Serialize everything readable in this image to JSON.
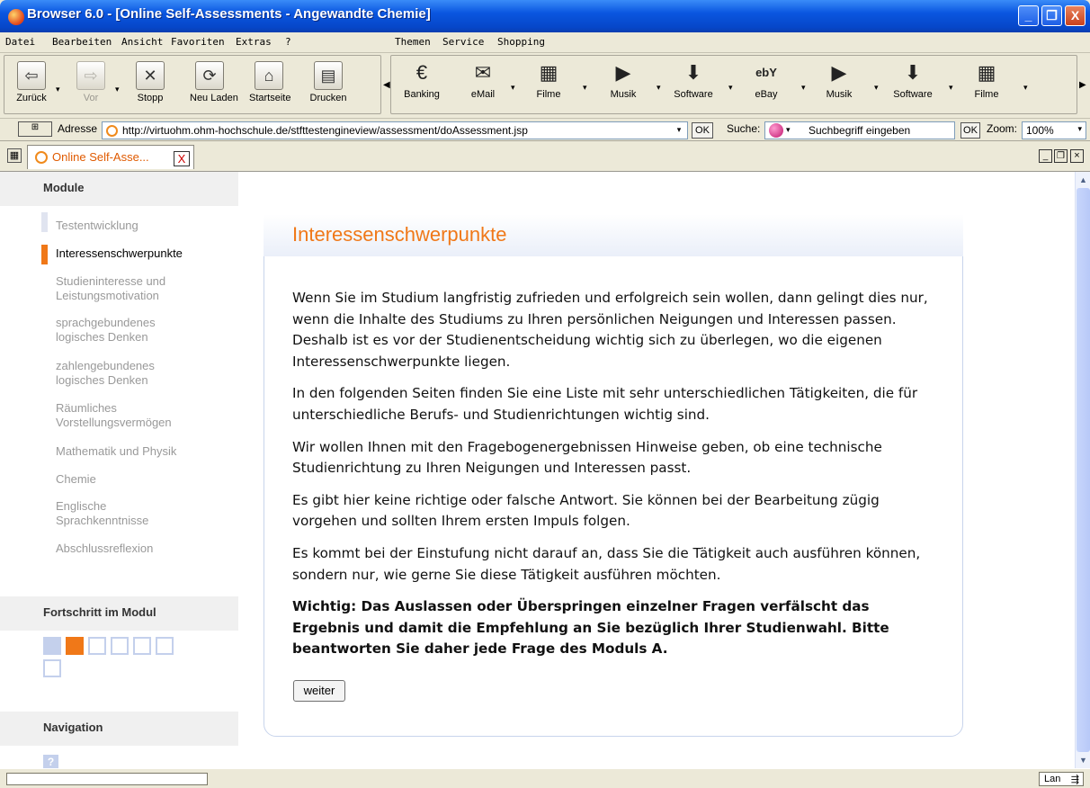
{
  "window": {
    "title": "Browser 6.0 - [Online Self-Assessments - Angewandte Chemie]",
    "minimize": "_",
    "maximize": "❐",
    "close": "X"
  },
  "menubar": {
    "items": [
      "Datei",
      "Bearbeiten",
      "Ansicht",
      "Favoriten",
      "Extras",
      "?",
      "Themen",
      "Service",
      "Shopping"
    ]
  },
  "toolbar": {
    "nav": [
      {
        "label": "Zurück",
        "icon": "back-arrow-icon",
        "glyph": "⇦"
      },
      {
        "label": "Vor",
        "icon": "forward-arrow-icon",
        "glyph": "⇨"
      },
      {
        "label": "Stopp",
        "icon": "stop-icon",
        "glyph": "✕"
      },
      {
        "label": "Neu Laden",
        "icon": "reload-icon",
        "glyph": "⟳"
      },
      {
        "label": "Startseite",
        "icon": "home-icon",
        "glyph": "⌂"
      },
      {
        "label": "Drucken",
        "icon": "print-icon",
        "glyph": "▤"
      }
    ],
    "links": [
      {
        "label": "Banking",
        "icon": "euro-icon",
        "glyph": "€"
      },
      {
        "label": "eMail",
        "icon": "mail-icon",
        "glyph": "✉"
      },
      {
        "label": "Filme",
        "icon": "film-icon",
        "glyph": "▦"
      },
      {
        "label": "Musik",
        "icon": "play-icon",
        "glyph": "▶"
      },
      {
        "label": "Software",
        "icon": "download-icon",
        "glyph": "⬇"
      },
      {
        "label": "eBay",
        "icon": "ebay-icon",
        "glyph": "ebY"
      },
      {
        "label": "Musik",
        "icon": "play-icon",
        "glyph": "▶"
      },
      {
        "label": "Software",
        "icon": "download-icon",
        "glyph": "⬇"
      },
      {
        "label": "Filme",
        "icon": "film-icon",
        "glyph": "▦"
      }
    ]
  },
  "address": {
    "label": "Adresse",
    "url": "http://virtuohm.ohm-hochschule.de/stfttestengineview/assessment/doAssessment.jsp",
    "ok": "OK",
    "search_label": "Suche:",
    "search_placeholder": "Suchbegriff eingeben",
    "search_ok": "OK",
    "zoom_label": "Zoom:",
    "zoom_value": "100%"
  },
  "tab": {
    "label": "Online Self-Asse...",
    "close": "X"
  },
  "sidebar": {
    "modules_heading": "Module",
    "modules": [
      {
        "label": "Testentwicklung",
        "active": false
      },
      {
        "label": "Interessenschwerpunkte",
        "active": true
      },
      {
        "label": "Studieninteresse und Leistungsmotivation",
        "active": false
      },
      {
        "label": "sprachgebundenes logisches Denken",
        "active": false
      },
      {
        "label": "zahlengebundenes logisches Denken",
        "active": false
      },
      {
        "label": "Räumliches Vorstellungsvermögen",
        "active": false
      },
      {
        "label": "Mathematik und Physik",
        "active": false
      },
      {
        "label": "Chemie",
        "active": false
      },
      {
        "label": "Englische Sprachkenntnisse",
        "active": false
      },
      {
        "label": "Abschlussreflexion",
        "active": false
      }
    ],
    "progress_heading": "Fortschritt im Modul",
    "progress": {
      "completed": 1,
      "current": 2,
      "total": 7
    },
    "navigation_heading": "Navigation",
    "help": "?"
  },
  "main": {
    "heading": "Interessenschwerpunkte",
    "paragraphs": [
      "Wenn Sie im Studium langfristig zufrieden und erfolgreich sein wollen, dann gelingt dies nur, wenn die Inhalte des Studiums zu Ihren persönlichen Neigungen und Interessen passen. Deshalb ist es vor der Studienentscheidung wichtig sich zu überlegen, wo die eigenen Interessenschwerpunkte liegen.",
      "In den folgenden Seiten finden Sie eine Liste mit sehr unterschiedlichen Tätigkeiten, die für unterschiedliche Berufs- und Studienrichtungen wichtig sind.",
      "Wir wollen Ihnen mit den Fragebogenergebnissen Hinweise geben, ob eine technische Studienrichtung zu Ihren Neigungen und Interessen passt.",
      "Es gibt hier keine richtige oder falsche Antwort. Sie können bei der Bearbeitung zügig vorgehen und sollten Ihrem ersten Impuls folgen.",
      "Es kommt bei der Einstufung nicht darauf an, dass Sie die Tätigkeit auch ausführen können, sondern nur, wie gerne Sie diese Tätigkeit ausführen möchten."
    ],
    "important": "Wichtig: Das Auslassen oder Überspringen einzelner Fragen verfälscht das Ergebnis und damit die Empfehlung an Sie bezüglich Ihrer Studienwahl. Bitte beantworten Sie daher jede Frage des Moduls A.",
    "next_button": "weiter"
  },
  "status": {
    "lan": "Lan"
  }
}
